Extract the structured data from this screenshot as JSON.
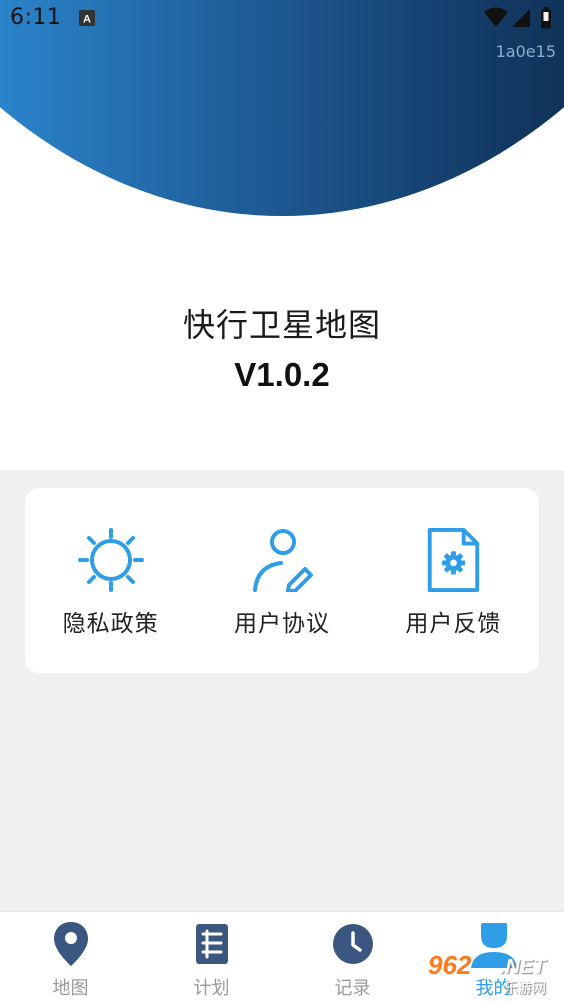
{
  "status_bar": {
    "time": "6:11",
    "icons": [
      "a-notification-icon",
      "wifi-icon",
      "signal-icon",
      "battery-icon"
    ]
  },
  "build_tag": "1a0e15",
  "app": {
    "name": "快行卫星地图",
    "version": "V1.0.2"
  },
  "colors": {
    "accent": "#2f9de8",
    "nav_inactive": "#3b5680",
    "gradient_start": "#2fa8f5",
    "gradient_end": "#0a1d38"
  },
  "actions": [
    {
      "label": "隐私政策",
      "icon": "sun-icon"
    },
    {
      "label": "用户协议",
      "icon": "user-edit-icon"
    },
    {
      "label": "用户反馈",
      "icon": "document-gear-icon"
    }
  ],
  "bottom_nav": {
    "items": [
      {
        "label": "地图",
        "icon": "map-pin-icon",
        "active": false
      },
      {
        "label": "计划",
        "icon": "list-icon",
        "active": false
      },
      {
        "label": "记录",
        "icon": "clock-icon",
        "active": false
      },
      {
        "label": "我的",
        "icon": "user-icon",
        "active": true
      }
    ]
  },
  "watermark": {
    "main": "962",
    "net": ".NET",
    "sub": "乐游网"
  }
}
